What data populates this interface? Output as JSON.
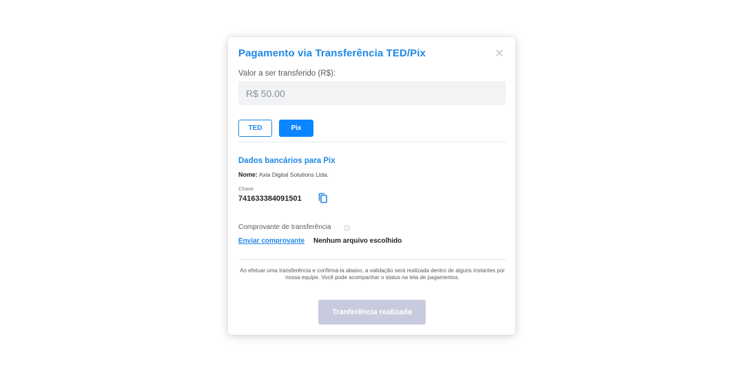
{
  "modal": {
    "title": "Pagamento via Transferência TED/Pix",
    "close_icon": "close-icon"
  },
  "amount": {
    "label": "Valor a ser transferido (R$):",
    "value": "R$ 50.00"
  },
  "tabs": [
    {
      "label": "TED",
      "selected": false
    },
    {
      "label": "Pix",
      "selected": true
    }
  ],
  "bank": {
    "section_title": "Dados bancários para Pix",
    "name_label": "Nome:",
    "name_value": "Axia Digital Solutions Ltda.",
    "key_label": "Chave:",
    "key_value": "741633384091501",
    "copy_icon": "copy-icon"
  },
  "receipt": {
    "label": "Comprovante de transferência",
    "info_icon": "info-icon",
    "send_link": "Enviar comprovante",
    "file_status": "Nenhum arquivo escolhido"
  },
  "notice": "Ao efetuar uma transferência e confirmá-la abaixo, a validação será realizada dentro de alguns instantes por nossa equipe. Você pode acompanhar o status na tela de pagamentos.",
  "submit": {
    "label": "Tranferência realizada",
    "disabled": true
  },
  "colors": {
    "accent": "#1f87e5",
    "pix_selected": "#0a84ff",
    "submit_disabled": "#c8cbde"
  }
}
